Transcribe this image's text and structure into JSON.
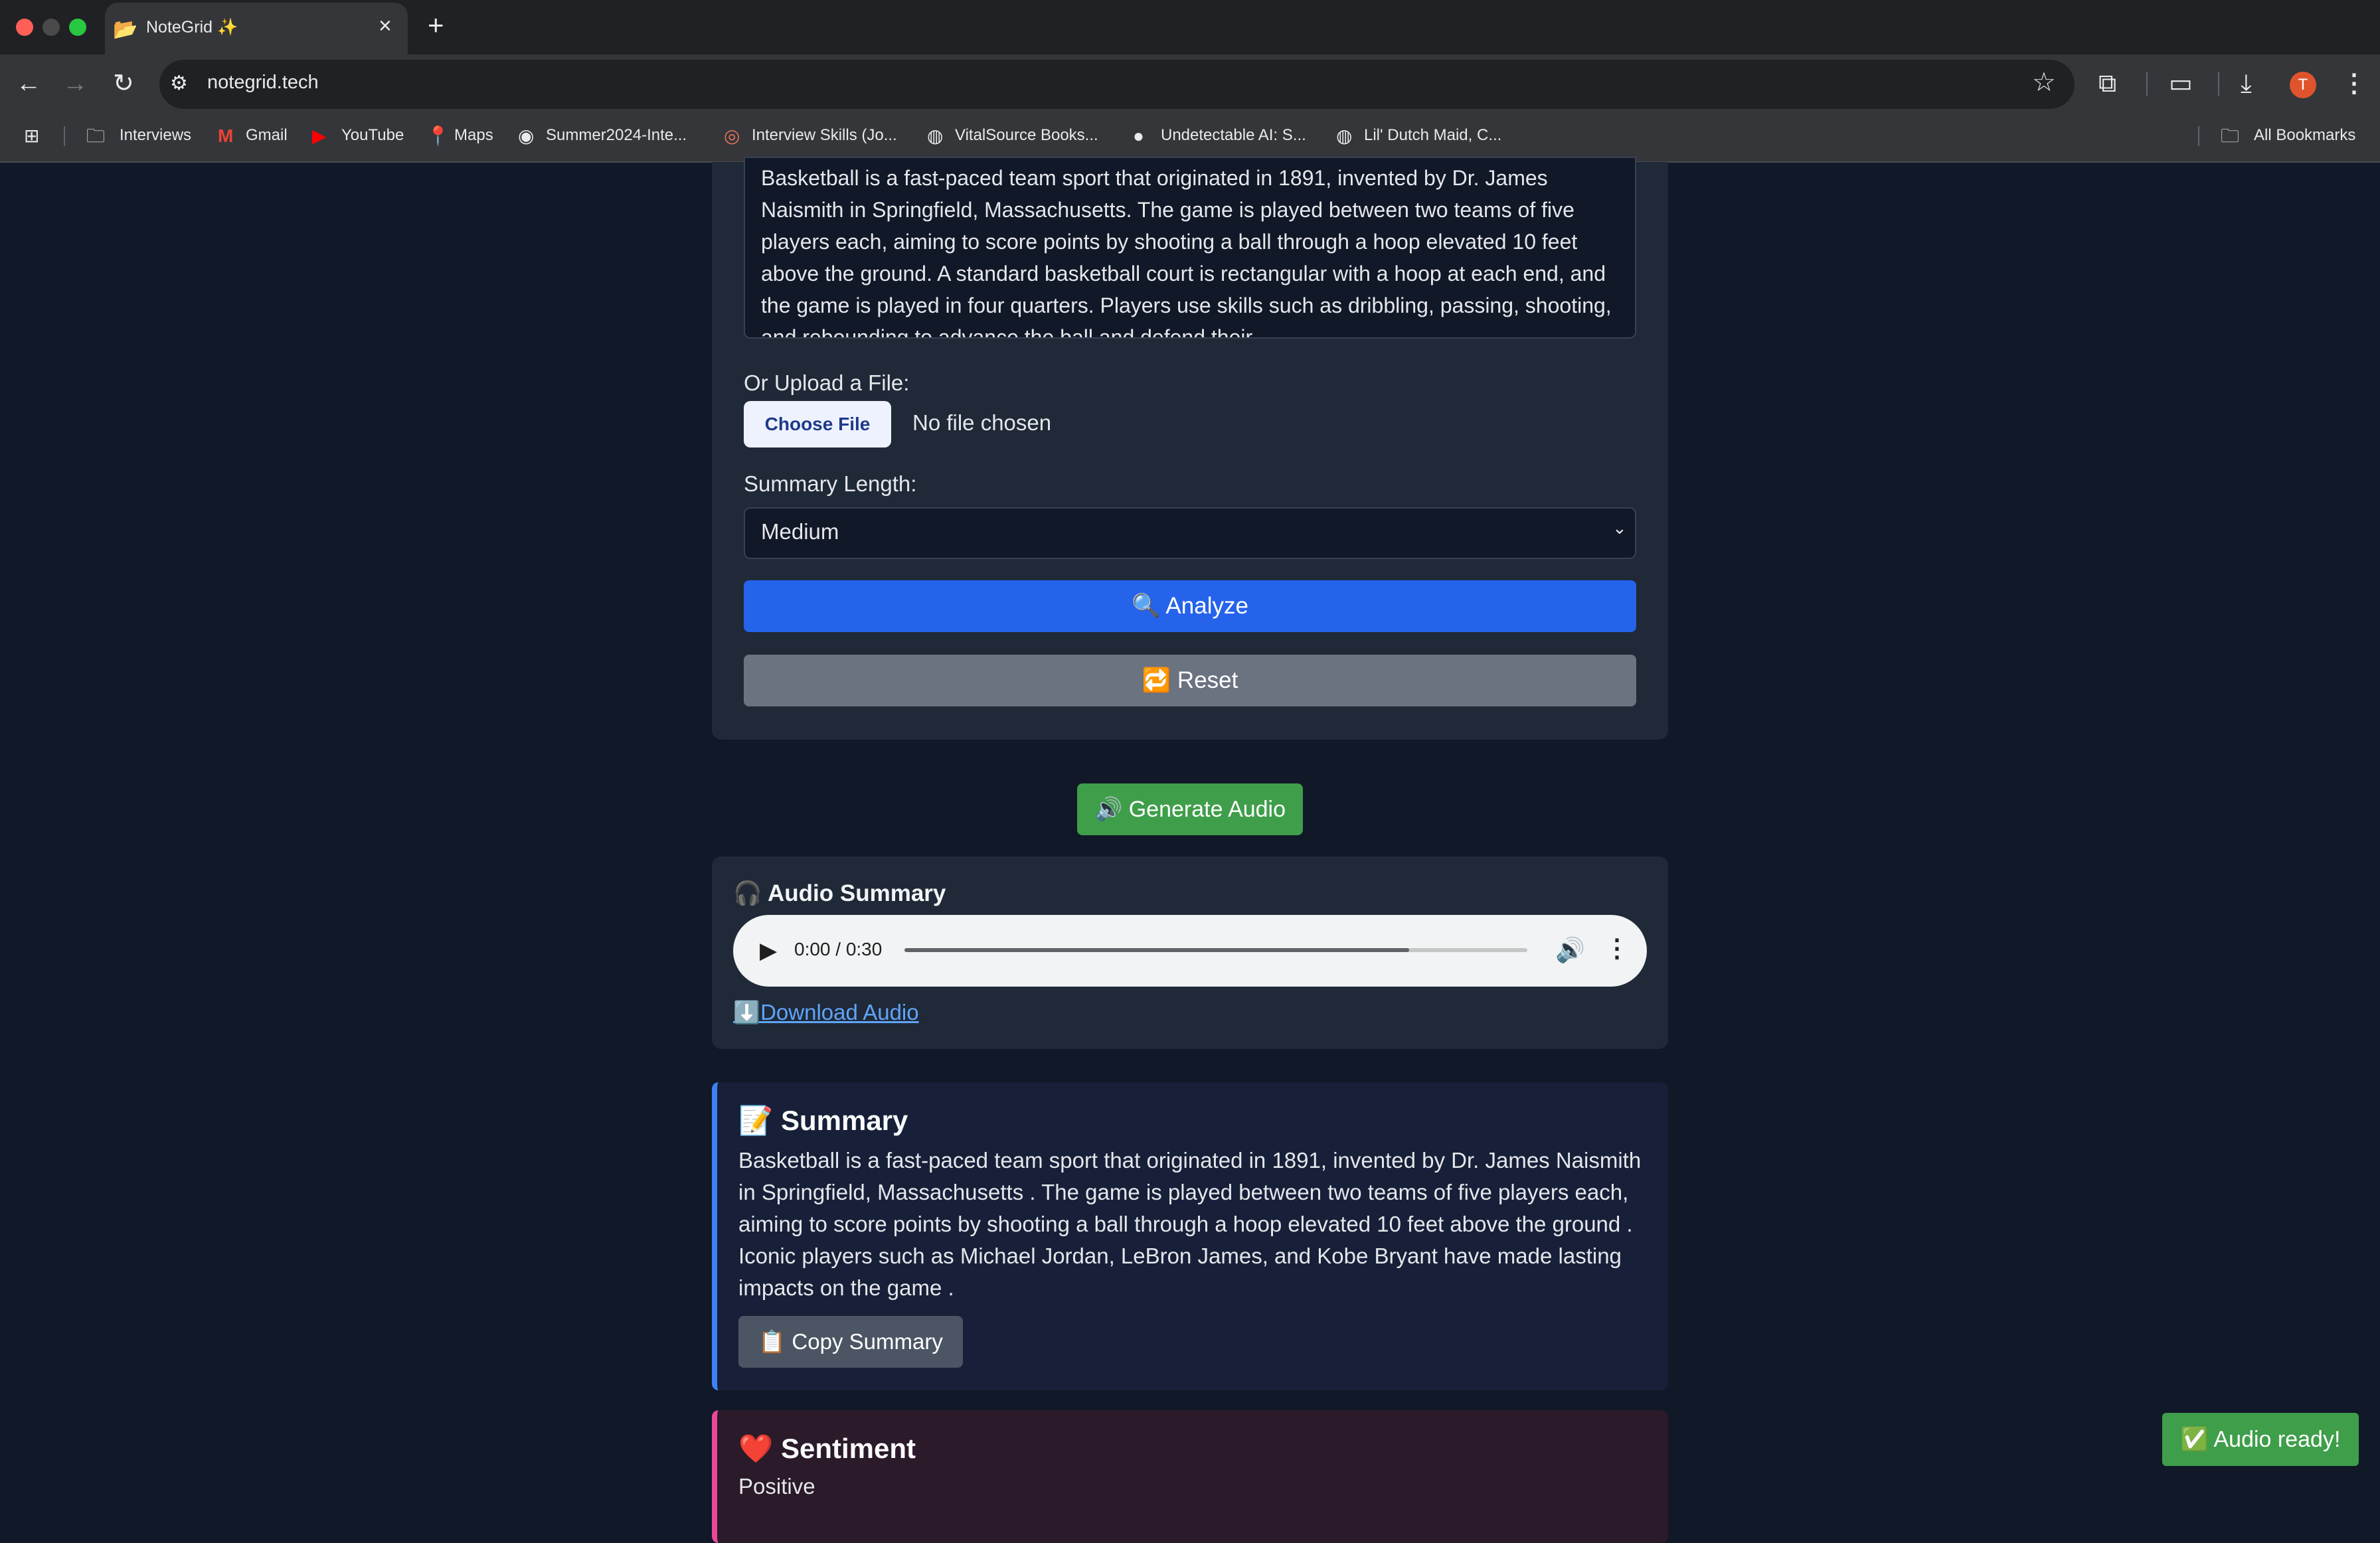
{
  "browser": {
    "tab_title": "NoteGrid ✨",
    "tab_favicon": "📂",
    "url": "notegrid.tech",
    "profile_initial": "T",
    "bookmarks": [
      {
        "label": "Interviews",
        "icon": "🗀"
      },
      {
        "label": "Gmail",
        "icon": "M"
      },
      {
        "label": "YouTube",
        "icon": "▶"
      },
      {
        "label": "Maps",
        "icon": "📍"
      },
      {
        "label": "Summer2024-Inte...",
        "icon": "◉"
      },
      {
        "label": "Interview Skills (Jo...",
        "icon": "◎"
      },
      {
        "label": "VitalSource Books...",
        "icon": "◍"
      },
      {
        "label": "Undetectable AI: S...",
        "icon": "●"
      },
      {
        "label": "Lil' Dutch Maid, C...",
        "icon": "◍"
      }
    ],
    "all_bookmarks_label": "All Bookmarks"
  },
  "input": {
    "text_value": "Basketball is a fast-paced team sport that originated in 1891, invented by Dr. James Naismith in Springfield, Massachusetts. The game is played between two teams of five players each, aiming to score points by shooting a ball through a hoop elevated 10 feet above the ground. A standard basketball court is rectangular with a hoop at each end, and the game is played in four quarters. Players use skills such as dribbling, passing, shooting, and rebounding to advance the ball and defend their",
    "upload_label": "Or Upload a File:",
    "choose_file_label": "Choose File",
    "no_file_text": "No file chosen",
    "length_label": "Summary Length:",
    "length_selected": "Medium",
    "analyze_label": "🔍 Analyze",
    "reset_label": "🔁 Reset"
  },
  "audio": {
    "generate_label": "🔊 Generate Audio",
    "heading": "🎧 Audio Summary",
    "time_readout": "0:00 / 0:30",
    "buffered_fraction": 0.81,
    "download_icon": "⬇️",
    "download_label": "Download Audio"
  },
  "summary": {
    "heading": "📝 Summary",
    "body": "Basketball is a fast-paced team sport that originated in 1891, invented by Dr. James Naismith in Springfield, Massachusetts . The game is played between two teams of five players each, aiming to score points by shooting a ball through a hoop elevated 10 feet above the ground . Iconic players such as Michael Jordan, LeBron James, and Kobe Bryant have made lasting impacts on the game .",
    "copy_label": "📋 Copy Summary"
  },
  "sentiment": {
    "heading": "❤️ Sentiment",
    "value": "Positive"
  },
  "toast": {
    "message": "✅ Audio ready!"
  },
  "colors": {
    "page_bg": "#111827",
    "panel_bg": "#1f2937",
    "analyze": "#2563eb",
    "reset": "#6b7280",
    "generate_audio": "#3f9e4a",
    "summary_accent": "#3b82f6",
    "sentiment_accent": "#ec4899"
  }
}
